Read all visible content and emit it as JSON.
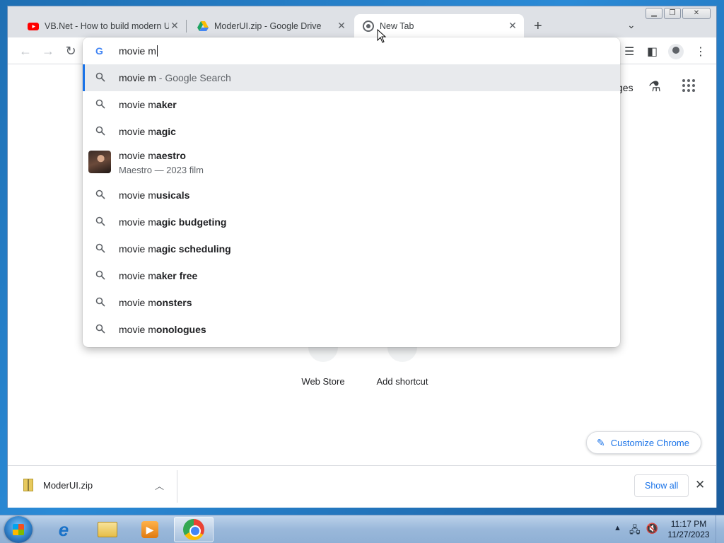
{
  "tabs": [
    {
      "title": "VB.Net - How to build modern UI",
      "icon": "youtube-icon"
    },
    {
      "title": "ModerUI.zip - Google Drive",
      "icon": "drive-icon"
    },
    {
      "title": "New Tab",
      "icon": "chrome-icon"
    }
  ],
  "omnibox": {
    "text": "movie m",
    "suggestions": [
      {
        "typed": "movie m",
        "completion": "",
        "suffix": " - Google Search"
      },
      {
        "typed": "movie m",
        "completion": "aker"
      },
      {
        "typed": "movie m",
        "completion": "agic"
      },
      {
        "typed": "movie m",
        "completion": "aestro",
        "subtitle": "Maestro — 2023 film"
      },
      {
        "typed": "movie m",
        "completion": "usicals"
      },
      {
        "typed": "movie m",
        "completion": "agic budgeting"
      },
      {
        "typed": "movie m",
        "completion": "agic scheduling"
      },
      {
        "typed": "movie m",
        "completion": "aker free"
      },
      {
        "typed": "movie m",
        "completion": "onsters"
      },
      {
        "typed": "movie m",
        "completion": "onologues"
      }
    ]
  },
  "newtab": {
    "images_partial": "ges",
    "shortcuts": [
      {
        "label": "Web Store"
      },
      {
        "label": "Add shortcut"
      }
    ],
    "customize_label": "Customize Chrome"
  },
  "downloads": {
    "file": "ModerUI.zip",
    "show_all": "Show all"
  },
  "taskbar": {
    "time": "11:17 PM",
    "date": "11/27/2023"
  },
  "colors": {
    "accent": "#1a73e8",
    "tabstrip": "#dee1e6",
    "selected_row": "#e8eaed"
  }
}
